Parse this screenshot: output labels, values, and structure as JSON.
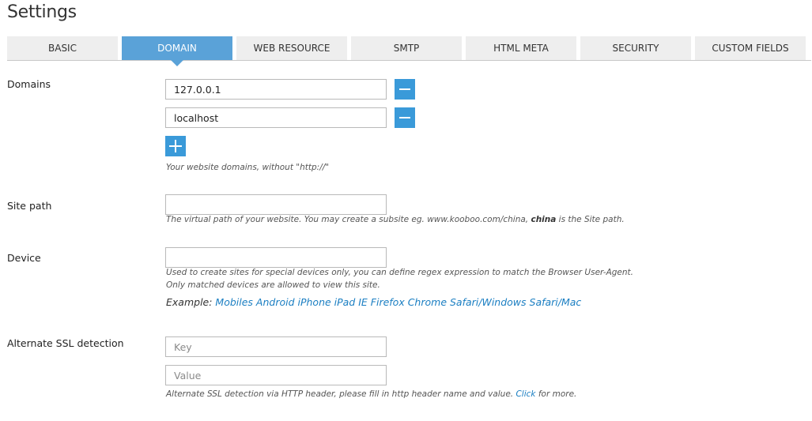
{
  "page": {
    "title": "Settings"
  },
  "tabs": [
    {
      "label": "BASIC"
    },
    {
      "label": "DOMAIN"
    },
    {
      "label": "WEB RESOURCE"
    },
    {
      "label": "SMTP"
    },
    {
      "label": "HTML META"
    },
    {
      "label": "SECURITY"
    },
    {
      "label": "CUSTOM FIELDS"
    }
  ],
  "active_tab": "DOMAIN",
  "domains": {
    "label": "Domains",
    "entries": [
      {
        "value": "127.0.0.1"
      },
      {
        "value": "localhost"
      }
    ],
    "hint": "Your website domains, without \"http://\""
  },
  "site_path": {
    "label": "Site path",
    "value": "",
    "hint_before": "The virtual path of your website. You may create a subsite eg. www.kooboo.com/china, ",
    "hint_bold": "china",
    "hint_after": " is the Site path."
  },
  "device": {
    "label": "Device",
    "value": "",
    "hint_line1": "Used to create sites for special devices only, you can define regex expression to match the Browser User-Agent.",
    "hint_line2": "Only matched devices are allowed to view this site.",
    "example_label": "Example: ",
    "example_value": "Mobiles Android iPhone iPad IE Firefox Chrome Safari/Windows Safari/Mac"
  },
  "ssl": {
    "label": "Alternate SSL detection",
    "key_placeholder": "Key",
    "value_placeholder": "Value",
    "hint_before": "Alternate SSL detection via HTTP header, please fill in http header name and value. ",
    "hint_link": "Click",
    "hint_after": " for more."
  },
  "colors": {
    "accent": "#3a9ad9",
    "active_tab": "#5aa2d8",
    "tab_bg": "#eeeeee",
    "link": "#1a7ec2"
  },
  "icons": {
    "remove": "minus-icon",
    "add": "plus-icon"
  }
}
